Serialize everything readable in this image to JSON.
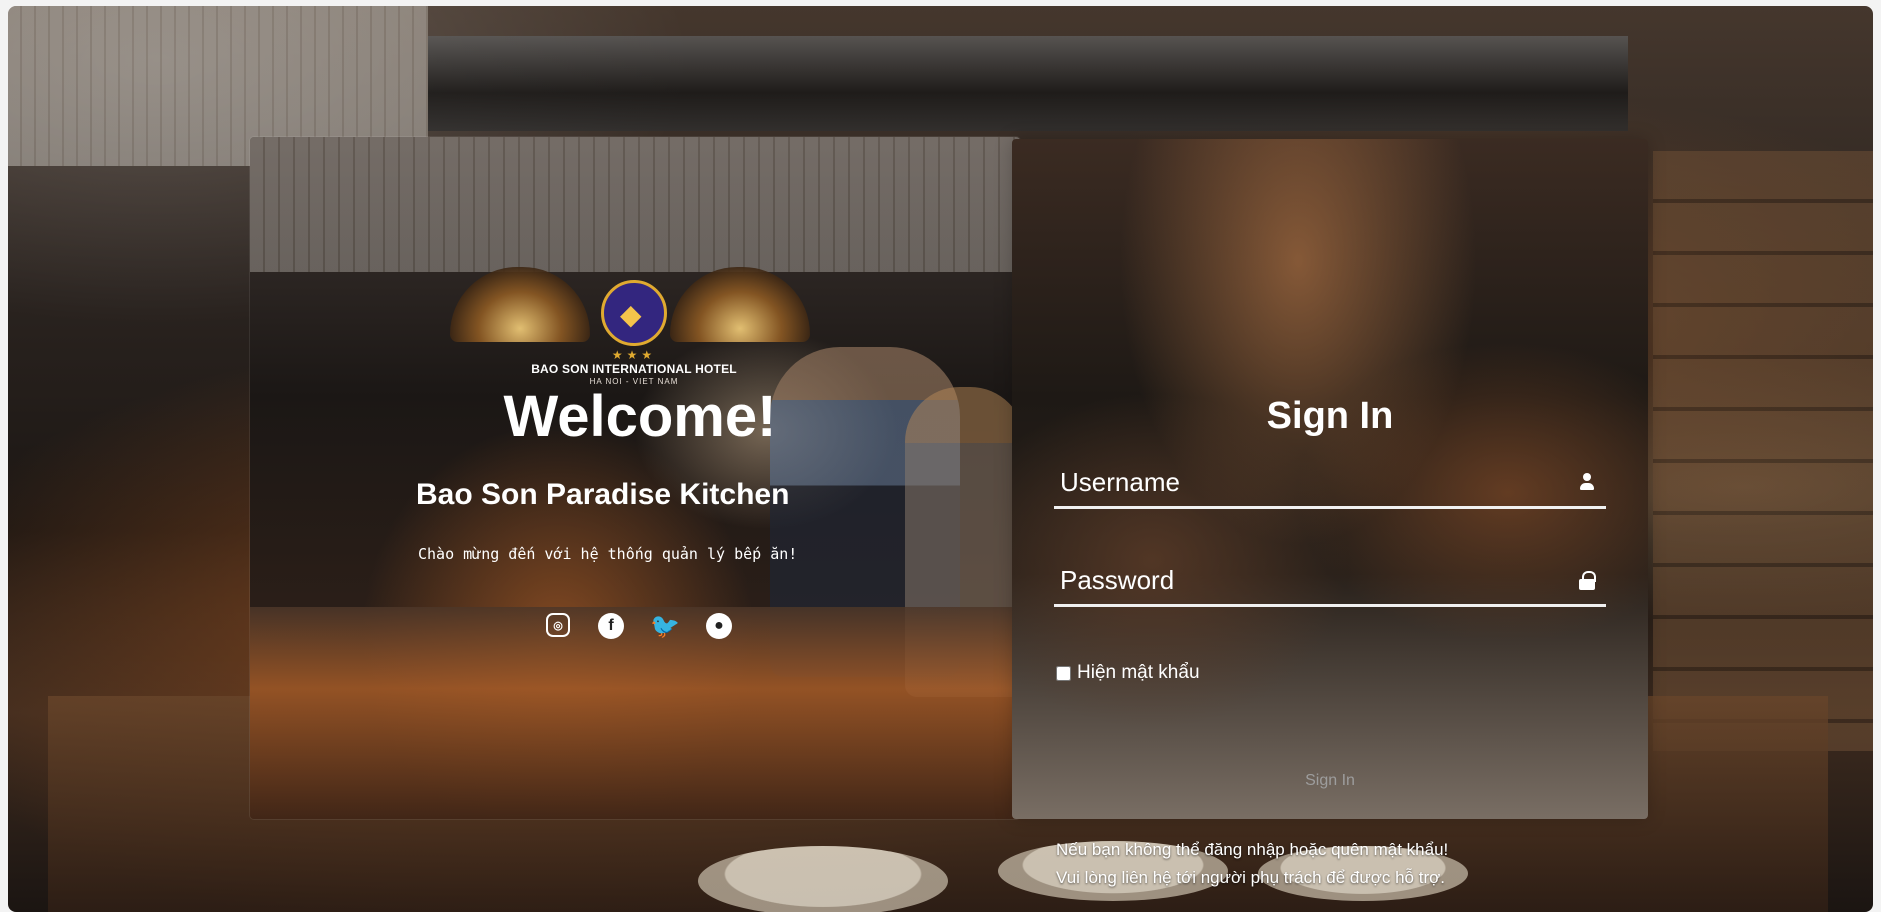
{
  "brand": {
    "logo_stars": "★★★",
    "hotel_name": "BAO SON INTERNATIONAL HOTEL",
    "location": "HA NOI - VIET NAM"
  },
  "hero": {
    "welcome": "Welcome!",
    "kitchen_name": "Bao Son Paradise Kitchen",
    "greeting": "Chào mừng đến với hệ thống quản lý bếp ăn!"
  },
  "social": [
    {
      "name": "instagram",
      "glyph": "◎"
    },
    {
      "name": "facebook",
      "glyph": "f"
    },
    {
      "name": "twitter",
      "glyph": "🐦"
    },
    {
      "name": "github",
      "glyph": "●"
    }
  ],
  "signin": {
    "title": "Sign In",
    "username_placeholder": "Username",
    "password_placeholder": "Password",
    "show_password_label": "Hiện mật khẩu",
    "button_label": "Sign In"
  },
  "support": {
    "line_1": "Nếu bạn không thể đăng nhập hoặc quên mật khẩu!",
    "line_2": "Vui lòng liên hệ tới người phụ trách để được hỗ trợ."
  },
  "colors": {
    "logo_navy": "#33267f",
    "logo_gold": "#e0aa30",
    "text_white": "#ffffff",
    "button_text": "#9d9d9d"
  }
}
